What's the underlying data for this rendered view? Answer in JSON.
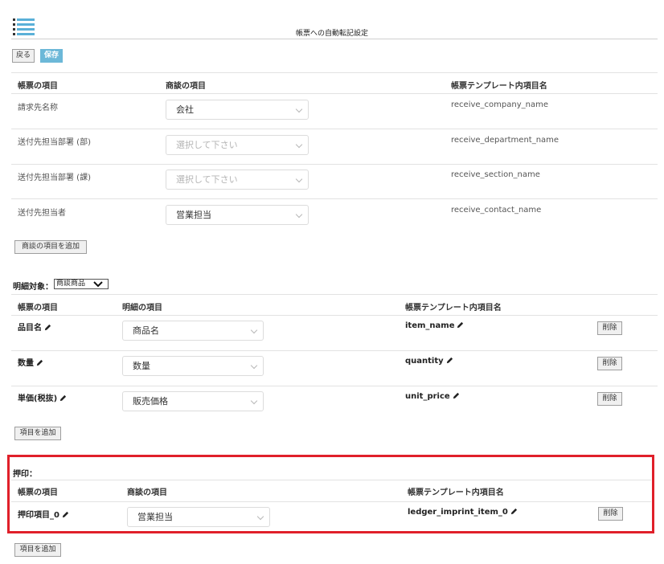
{
  "header": {
    "title": "帳票への自動転記設定",
    "menu_icon": "hamburger-list-icon"
  },
  "toolbar": {
    "back_label": "戻る",
    "save_label": "保存",
    "save_color": "#6cb8d8"
  },
  "deal_section": {
    "headers": [
      "帳票の項目",
      "商談の項目",
      "帳票テンプレート内項目名"
    ],
    "rows": [
      {
        "label": "請求先名称",
        "value": "会社",
        "placeholder": false,
        "template": "receive_company_name"
      },
      {
        "label": "送付先担当部署 (部)",
        "value": "選択して下さい",
        "placeholder": true,
        "template": "receive_department_name"
      },
      {
        "label": "送付先担当部署 (課)",
        "value": "選択して下さい",
        "placeholder": true,
        "template": "receive_section_name"
      },
      {
        "label": "送付先担当者",
        "value": "営業担当",
        "placeholder": false,
        "template": "receive_contact_name"
      }
    ],
    "add_label": "商談の項目を追加"
  },
  "detail_section": {
    "target_label": "明細対象：",
    "target_value": "商談商品",
    "headers": [
      "帳票の項目",
      "明細の項目",
      "帳票テンプレート内項目名"
    ],
    "rows": [
      {
        "label": "品目名",
        "value": "商品名",
        "template": "item_name",
        "delete": "削除"
      },
      {
        "label": "数量",
        "value": "数量",
        "template": "quantity",
        "delete": "削除"
      },
      {
        "label": "単価(税抜)",
        "value": "販売価格",
        "template": "unit_price",
        "delete": "削除"
      }
    ],
    "add_label": "項目を追加"
  },
  "imprint_section": {
    "title": "押印：",
    "highlight_color": "#e0202a",
    "headers": [
      "帳票の項目",
      "商談の項目",
      "帳票テンプレート内項目名"
    ],
    "rows": [
      {
        "label": "押印項目_0",
        "value": "営業担当",
        "template": "ledger_imprint_item_0",
        "delete": "削除"
      }
    ],
    "add_label": "項目を追加"
  }
}
